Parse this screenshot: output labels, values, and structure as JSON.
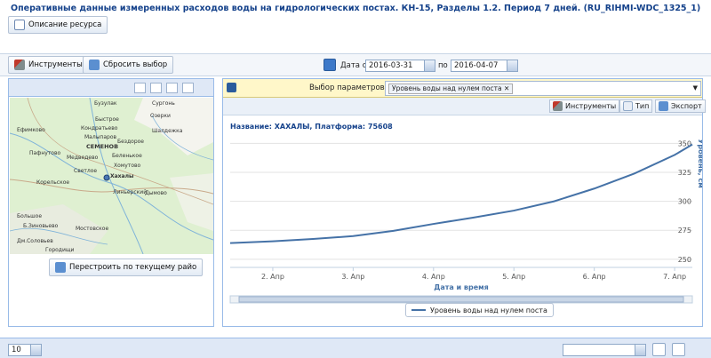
{
  "page": {
    "title": "Оперативные данные измеренных расходов воды на гидрологических постах. КН-15, Разделы 1.2. Период 7 дней. (RU_RIHMI-WDC_1325_1)",
    "description_button": "Описание ресурса"
  },
  "toolbar": {
    "tools_label": "Инструменты",
    "reset_label": "Сбросить выбор",
    "date_from_label": "Дата с",
    "date_from": "2016-03-31",
    "date_to_label": "по",
    "date_to": "2016-04-07"
  },
  "map": {
    "rebuild_button": "Перестроить по текущему райо",
    "places": [
      "Бузулак",
      "Сургонь",
      "Озерки",
      "Быстрое",
      "Ефимково",
      "Кондратьево",
      "Шалдежка",
      "Бездорое",
      "Малыпаров",
      "Пафнутово",
      "СЕМЕНОВ",
      "Медведево",
      "Беленькое",
      "Хомутово",
      "Светлое",
      "Хахалы",
      "Корельское",
      "Линьерский",
      "Дымово",
      "Большое",
      "Б.Зиновьево",
      "Мостовское",
      "Дм.Соловьев",
      "Городищи"
    ]
  },
  "params": {
    "label": "Выбор параметров:",
    "selected_tag": "Уровень воды над нулем поста"
  },
  "chart_tools": {
    "tools_label": "Инструменты",
    "type_label": "Тип",
    "export_label": "Экспорт"
  },
  "chart_data": {
    "type": "line",
    "title": "Название: ХАХАЛЫ, Платформа: 75608",
    "xlabel": "Дата и время",
    "ylabel": "Уровень, см",
    "x_ticks": [
      "2. Апр",
      "3. Апр",
      "4. Апр",
      "5. Апр",
      "6. Апр",
      "7. Апр"
    ],
    "y_ticks": [
      250,
      275,
      300,
      325,
      350
    ],
    "xlim": [
      1.47,
      7.22
    ],
    "ylim": [
      243,
      361
    ],
    "grid": true,
    "legend_position": "bottom-center",
    "series": [
      {
        "name": "Уровень воды над нулем поста",
        "color": "#4572a7",
        "x": [
          1.47,
          2.0,
          2.5,
          3.0,
          3.5,
          4.0,
          4.5,
          5.0,
          5.5,
          6.0,
          6.5,
          7.0,
          7.22
        ],
        "values": [
          264,
          265.5,
          267.5,
          270,
          274.5,
          280.5,
          286,
          292,
          300,
          311,
          324,
          340,
          349
        ]
      }
    ]
  },
  "paging": {
    "page_size": "10"
  }
}
